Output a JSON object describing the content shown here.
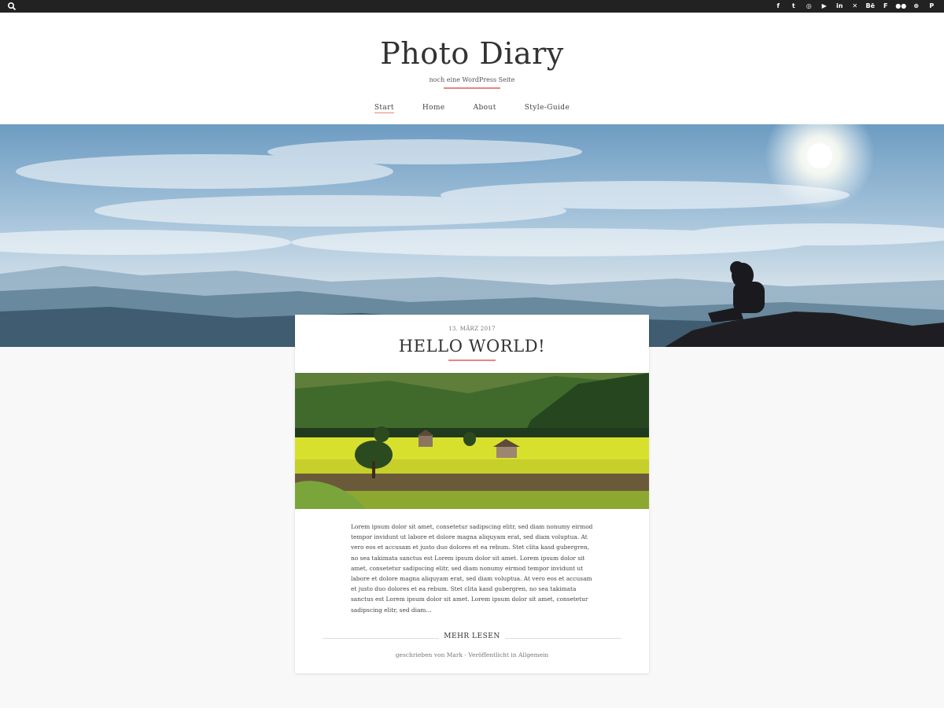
{
  "topbar": {
    "search_icon": "search-icon",
    "social": [
      {
        "name": "facebook-icon",
        "glyph": "f"
      },
      {
        "name": "twitter-icon",
        "glyph": "t"
      },
      {
        "name": "instagram-icon",
        "glyph": "◎"
      },
      {
        "name": "youtube-icon",
        "glyph": "▶"
      },
      {
        "name": "linkedin-icon",
        "glyph": "in"
      },
      {
        "name": "xing-icon",
        "glyph": "✕"
      },
      {
        "name": "behance-icon",
        "glyph": "Bē"
      },
      {
        "name": "foursquare-icon",
        "glyph": "F"
      },
      {
        "name": "flickr-icon",
        "glyph": "●●"
      },
      {
        "name": "dribbble-icon",
        "glyph": "⊕"
      },
      {
        "name": "pinterest-icon",
        "glyph": "P"
      }
    ]
  },
  "header": {
    "site_title": "Photo Diary",
    "tagline": "noch eine WordPress Seite",
    "accent_color": "#e8857f"
  },
  "nav": {
    "items": [
      {
        "label": "Start",
        "active": true
      },
      {
        "label": "Home",
        "active": false
      },
      {
        "label": "About",
        "active": false
      },
      {
        "label": "Style-Guide",
        "active": false
      }
    ]
  },
  "post": {
    "date": "13. MÄRZ 2017",
    "title": "HELLO WORLD!",
    "excerpt": "Lorem ipsum dolor sit amet, consetetur sadipscing elitr, sed diam nonumy eirmod tempor invidunt ut labore et dolore magna aliquyam erat, sed diam voluptua. At vero eos et accusam et justo duo dolores et ea rebum. Stet clita kasd gubergren, no sea takimata sanctus est Lorem ipsum dolor sit amet. Lorem ipsum dolor sit amet, consetetur sadipscing elitr, sed diam nonumy eirmod tempor invidunt ut labore et dolore magna aliquyam erat, sed diam voluptua. At vero eos et accusam et justo duo dolores et ea rebum. Stet clita kasd gubergren, no sea takimata sanctus est Lorem ipsum dolor sit amet. Lorem ipsum dolor sit amet, consetetur sadipscing elitr, sed diam…",
    "read_more": "MEHR LESEN",
    "meta": "geschrieben von Mark - Veröffentlicht in Allgemein"
  }
}
